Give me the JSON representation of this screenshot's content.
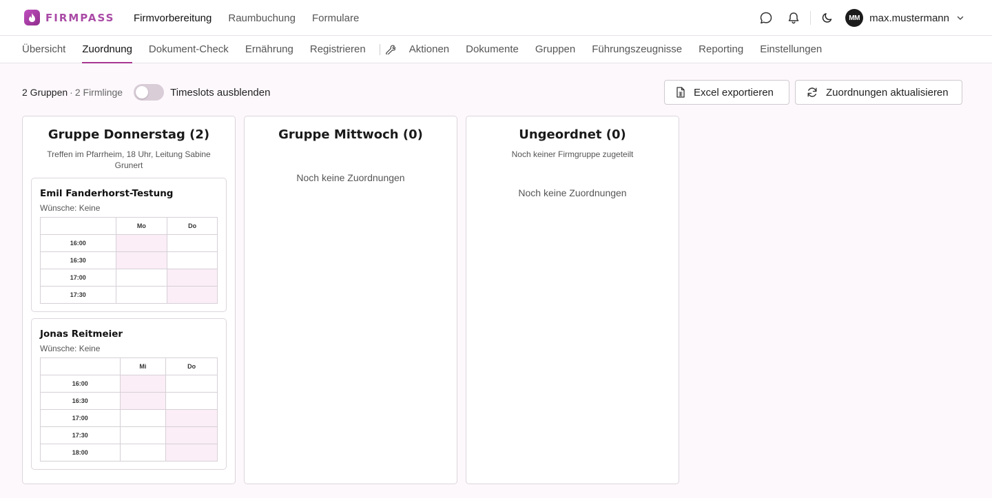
{
  "app": {
    "logo_text": "FIRMPASS",
    "accent": "#a6378f"
  },
  "mainnav": {
    "items": [
      {
        "label": "Firmvorbereitung",
        "active": true
      },
      {
        "label": "Raumbuchung",
        "active": false
      },
      {
        "label": "Formulare",
        "active": false
      }
    ]
  },
  "header": {
    "icons": [
      "chat-icon",
      "bell-icon",
      "moon-icon"
    ],
    "avatar_initials": "MM",
    "username": "max.mustermann"
  },
  "subnav": {
    "tabs": [
      {
        "label": "Übersicht"
      },
      {
        "label": "Zuordnung",
        "active": true
      },
      {
        "label": "Dokument-Check"
      },
      {
        "label": "Ernährung"
      },
      {
        "label": "Registrieren"
      }
    ],
    "admin_tabs": [
      {
        "label": "Aktionen"
      },
      {
        "label": "Dokumente"
      },
      {
        "label": "Gruppen"
      },
      {
        "label": "Führungszeugnisse"
      },
      {
        "label": "Reporting"
      },
      {
        "label": "Einstellungen"
      }
    ]
  },
  "toolbar": {
    "groups_count": "2 Gruppen",
    "separator": "·",
    "firmlinge_count": "2 Firmlinge",
    "toggle_label": "Timeslots ausblenden",
    "toggle_on": false,
    "export_label": "Excel exportieren",
    "refresh_label": "Zuordnungen aktualisieren"
  },
  "columns": [
    {
      "title": "Gruppe Donnerstag (2)",
      "subtitle": "Treffen im Pfarrheim, 18 Uhr, Leitung Sabine Grunert",
      "cards": [
        {
          "name": "Emil Fanderhorst-Testung",
          "wishes": "Wünsche: Keine",
          "days": [
            "Mo",
            "Do"
          ],
          "rows": [
            {
              "time": "16:00",
              "slots": [
                true,
                false
              ]
            },
            {
              "time": "16:30",
              "slots": [
                true,
                false
              ]
            },
            {
              "time": "17:00",
              "slots": [
                false,
                true
              ]
            },
            {
              "time": "17:30",
              "slots": [
                false,
                true
              ]
            }
          ]
        },
        {
          "name": "Jonas Reitmeier",
          "wishes": "Wünsche: Keine",
          "days": [
            "Mi",
            "Do"
          ],
          "rows": [
            {
              "time": "16:00",
              "slots": [
                true,
                false
              ]
            },
            {
              "time": "16:30",
              "slots": [
                true,
                false
              ]
            },
            {
              "time": "17:00",
              "slots": [
                false,
                true
              ]
            },
            {
              "time": "17:30",
              "slots": [
                false,
                true
              ]
            },
            {
              "time": "18:00",
              "slots": [
                false,
                true
              ]
            }
          ]
        }
      ]
    },
    {
      "title": "Gruppe Mittwoch (0)",
      "empty_text": "Noch keine Zuordnungen"
    },
    {
      "title": "Ungeordnet (0)",
      "subtitle": "Noch keiner Firmgruppe zugeteilt",
      "empty_text": "Noch keine Zuordnungen"
    }
  ]
}
